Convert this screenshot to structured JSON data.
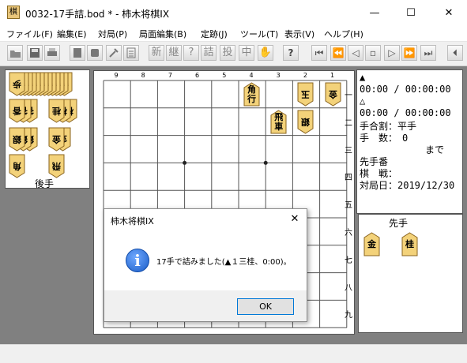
{
  "window": {
    "app_icon_text": "棋",
    "title": "0032-17手詰.bod * - 柿木将棋IX",
    "minimize_glyph": "—",
    "maximize_glyph": "☐",
    "close_glyph": "✕"
  },
  "menu": [
    "ファイル(F)",
    "編集(E)",
    "対局(P)",
    "局面編集(B)",
    "定跡(J)",
    "ツール(T)",
    "表示(V)",
    "ヘルプ(H)"
  ],
  "toolbar": {
    "file_icons": [
      "open-folder-icon",
      "save-disk-icon",
      "print-icon",
      "book-icon",
      "book2-icon",
      "tools-icon",
      "document-icon"
    ],
    "kanji_buttons": [
      "新",
      "継",
      "?",
      "詰",
      "投",
      "中",
      "✋"
    ],
    "help_label": "?",
    "nav_glyphs": [
      "⏮",
      "⏪",
      "◁",
      "▫",
      "▷",
      "⏩",
      "⏭",
      "⏴"
    ]
  },
  "gote_hand": {
    "label": "後手",
    "pieces": [
      {
        "kanji": "歩",
        "count": 13
      },
      {
        "kanji": "香",
        "count": 3
      },
      {
        "kanji": "桂",
        "count": 3
      },
      {
        "kanji": "銀",
        "count": 3
      },
      {
        "kanji": "金",
        "count": 2
      },
      {
        "kanji": "角",
        "count": 1
      },
      {
        "kanji": "飛",
        "count": 1
      }
    ]
  },
  "sente_hand": {
    "label": "先手",
    "pieces": [
      {
        "kanji": "金",
        "count": 1
      },
      {
        "kanji": "桂",
        "count": 1
      }
    ]
  },
  "board": {
    "files": [
      "9",
      "8",
      "7",
      "6",
      "5",
      "4",
      "3",
      "2",
      "1"
    ],
    "ranks": [
      "一",
      "二",
      "三",
      "四",
      "五",
      "六",
      "七",
      "八",
      "九"
    ],
    "pieces": [
      {
        "label": "角行",
        "owner": "sente",
        "file": 4,
        "rank": 1
      },
      {
        "label": "玉",
        "owner": "gote",
        "file": 2,
        "rank": 1
      },
      {
        "label": "金",
        "owner": "gote",
        "file": 1,
        "rank": 1
      },
      {
        "label": "飛車",
        "owner": "sente",
        "file": 3,
        "rank": 2
      },
      {
        "label": "銀",
        "owner": "gote",
        "file": 2,
        "rank": 2
      }
    ]
  },
  "info": {
    "sente_mark": "▲",
    "sente_time": "00:00 / 00:00:00",
    "gote_mark": "△",
    "gote_time": "00:00 / 00:00:00",
    "handicap": "手合割：平手",
    "moves": "手　数：　0",
    "made": "まで",
    "turn": "先手番",
    "event": "棋　戦：",
    "date": "対局日：2019/12/30"
  },
  "dialog": {
    "title": "柿木将棋IX",
    "close_glyph": "✕",
    "icon_glyph": "i",
    "message": "17手で詰みました(▲１三桂、0:00)。",
    "ok_label": "OK"
  },
  "colors": {
    "piece_fill": "#f3d27a",
    "piece_stroke": "#8a6420",
    "board_bg": "#ffffff",
    "client_bg": "#808080",
    "accent": "#0078d7"
  }
}
